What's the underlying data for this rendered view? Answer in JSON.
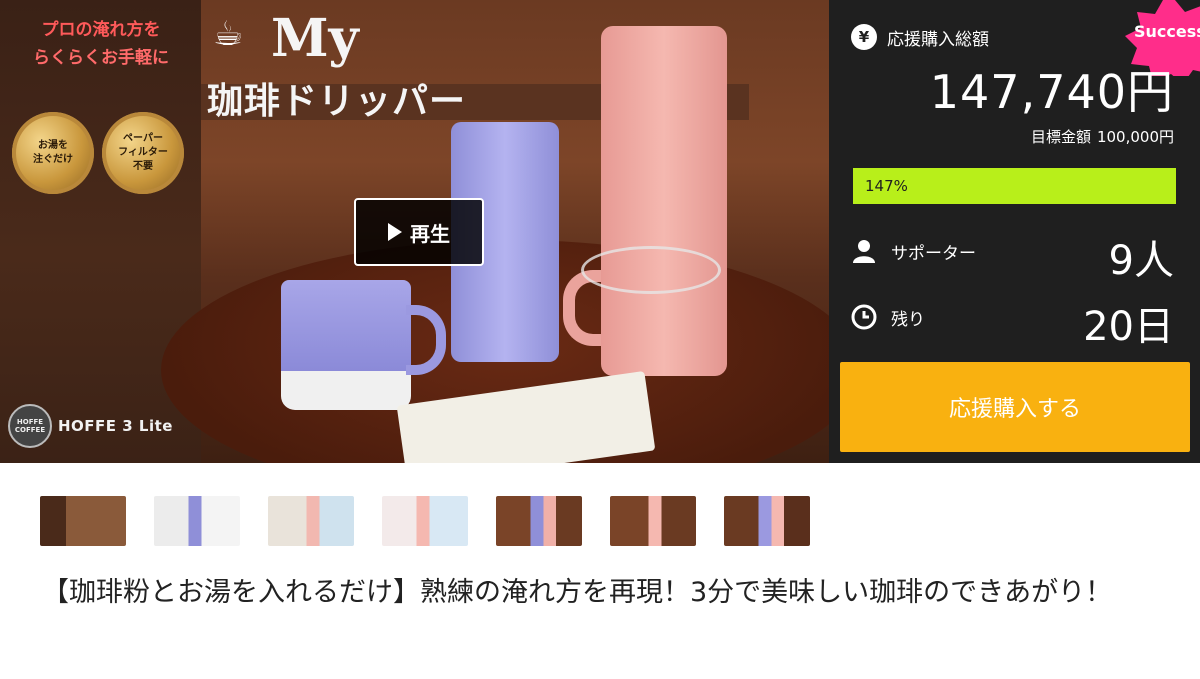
{
  "hero": {
    "catch_line1": "プロの淹れ方を",
    "catch_line2": "らくらくお手軽に",
    "badge1": "お湯を\n注ぐだけ",
    "badge2": "ペーパー\nフィルター\n不要",
    "brand_logo": "HOFFE COFFEE",
    "brand_name": "HOFFE 3 Lite",
    "title_my": "My",
    "title_jp": "珈琲ドリッパー",
    "play_label": "再生"
  },
  "panel": {
    "ribbon_label": "Success",
    "total_label": "応援購入総額",
    "total_amount": "147,740円",
    "goal_label": "目標金額",
    "goal_amount": "100,000円",
    "progress_text": "147%",
    "progress_percent": 147,
    "supporters_label": "サポーター",
    "supporters_value": "9人",
    "remaining_label": "残り",
    "remaining_value": "20日",
    "buy_button": "応援購入する",
    "colors": {
      "panel_bg": "#1f1f1f",
      "progress": "#b8ef1a",
      "buy_button": "#f9b110",
      "ribbon": "#ff2d8a"
    }
  },
  "thumbnails": [
    "thumb-1",
    "thumb-2",
    "thumb-3",
    "thumb-4",
    "thumb-5",
    "thumb-6",
    "thumb-7"
  ],
  "project": {
    "title": "【珈琲粉とお湯を入れるだけ】熟練の淹れ方を再現！3分で美味しい珈琲のできあがり！"
  }
}
